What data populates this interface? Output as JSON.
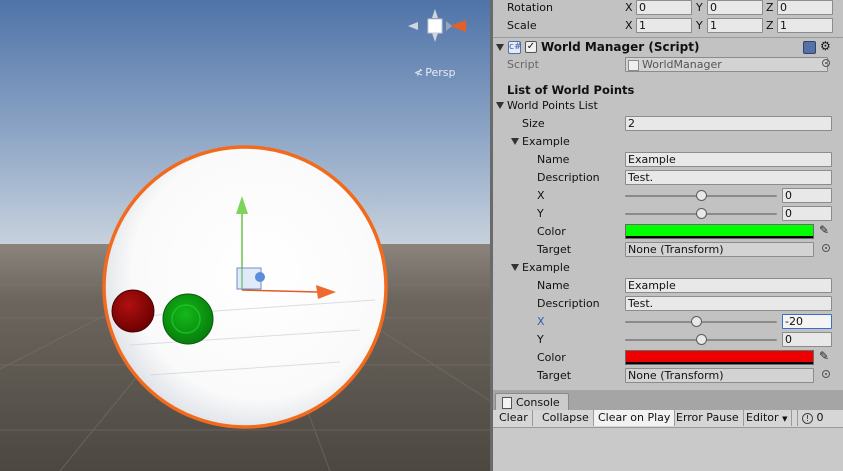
{
  "scene": {
    "persp_label": "Persp",
    "colors": {
      "sky_top": "#5b7cae",
      "sky_horizon": "#b9c7d8",
      "ground": "#5c564e",
      "sphere": "#ffffff",
      "sphere_outline": "#f26b1d",
      "red_ball": "#8b0000",
      "green_ball": "#0a9a10"
    }
  },
  "inspector": {
    "transform": {
      "rotation": {
        "label": "Rotation",
        "x": "0",
        "y": "0",
        "z": "0"
      },
      "scale": {
        "label": "Scale",
        "x": "1",
        "y": "1",
        "z": "1"
      },
      "axis_x": "X",
      "axis_y": "Y",
      "axis_z": "Z"
    },
    "component": {
      "title": "World Manager (Script)",
      "enabled_mark": "✓",
      "script_label": "Script",
      "script_value": "WorldManager"
    },
    "list_header": "List of World Points",
    "list_foldout": "World Points List",
    "size_label": "Size",
    "size_value": "2",
    "elements": [
      {
        "header": "Example",
        "name_label": "Name",
        "name_value": "Example",
        "desc_label": "Description",
        "desc_value": "Test.",
        "x_label": "X",
        "x_value": "0",
        "x_slider": 0.5,
        "y_label": "Y",
        "y_value": "0",
        "y_slider": 0.5,
        "color_label": "Color",
        "color": "#00ff00",
        "target_label": "Target",
        "target_value": "None (Transform)"
      },
      {
        "header": "Example",
        "name_label": "Name",
        "name_value": "Example",
        "desc_label": "Description",
        "desc_value": "Test.",
        "x_label": "X",
        "x_value": "-20",
        "x_slider": 0.47,
        "y_label": "Y",
        "y_value": "0",
        "y_slider": 0.5,
        "color_label": "Color",
        "color": "#ee0000",
        "target_label": "Target",
        "target_value": "None (Transform)"
      }
    ]
  },
  "console": {
    "tab_label": "Console",
    "buttons": {
      "clear": "Clear",
      "collapse": "Collapse",
      "clear_on_play": "Clear on Play",
      "error_pause": "Error Pause",
      "editor": "Editor",
      "count": "0"
    }
  }
}
